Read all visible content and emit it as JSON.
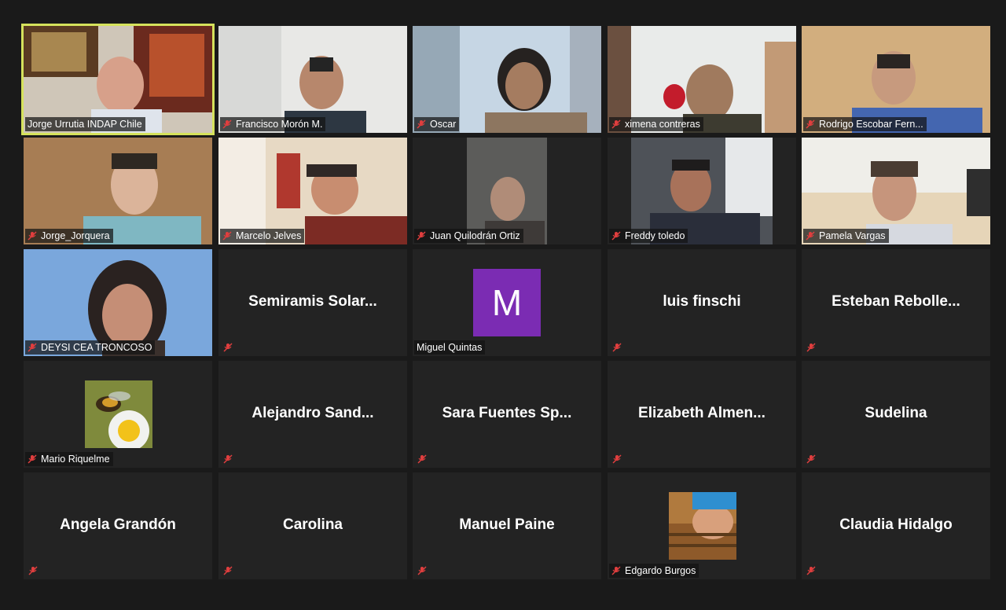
{
  "participants": [
    {
      "name": "Jorge Urrutia INDAP Chile",
      "video": true,
      "active": true
    },
    {
      "name": "Francisco Morón M.",
      "video": true
    },
    {
      "name": "Oscar",
      "video": true
    },
    {
      "name": "ximena contreras",
      "video": true
    },
    {
      "name": "Rodrigo Escobar Fern...",
      "video": true
    },
    {
      "name": "Jorge_Jorquera",
      "video": true
    },
    {
      "name": "Marcelo Jelves",
      "video": true
    },
    {
      "name": "Juan Quilodrán Ortiz",
      "video": true
    },
    {
      "name": "Freddy toledo",
      "video": true
    },
    {
      "name": "Pamela Vargas",
      "video": true
    },
    {
      "name": "DEYSI CEA TRONCOSO",
      "video": true
    },
    {
      "display_name": "Semiramis  Solar..."
    },
    {
      "name": "Miguel Quintas",
      "avatar_letter": "M"
    },
    {
      "display_name": "luis finschi"
    },
    {
      "display_name": "Esteban  Rebolle..."
    },
    {
      "name": "Mario Riquelme",
      "photo": "bee-photo"
    },
    {
      "display_name": "Alejandro  Sand..."
    },
    {
      "display_name": "Sara  Fuentes  Sp..."
    },
    {
      "display_name": "Elizabeth  Almen..."
    },
    {
      "display_name": "Sudelina"
    },
    {
      "display_name": "Angela Grandón"
    },
    {
      "display_name": "Carolina"
    },
    {
      "display_name": "Manuel Paine"
    },
    {
      "name": "Edgardo Burgos",
      "photo": "person-photo"
    },
    {
      "display_name": "Claudia Hidalgo"
    }
  ],
  "colors": {
    "background": "#1a1a1a",
    "tile": "#232323",
    "active_speaker": "#d5e25c",
    "muted_icon": "#e03e3e",
    "avatar": "#7b2cb3"
  }
}
